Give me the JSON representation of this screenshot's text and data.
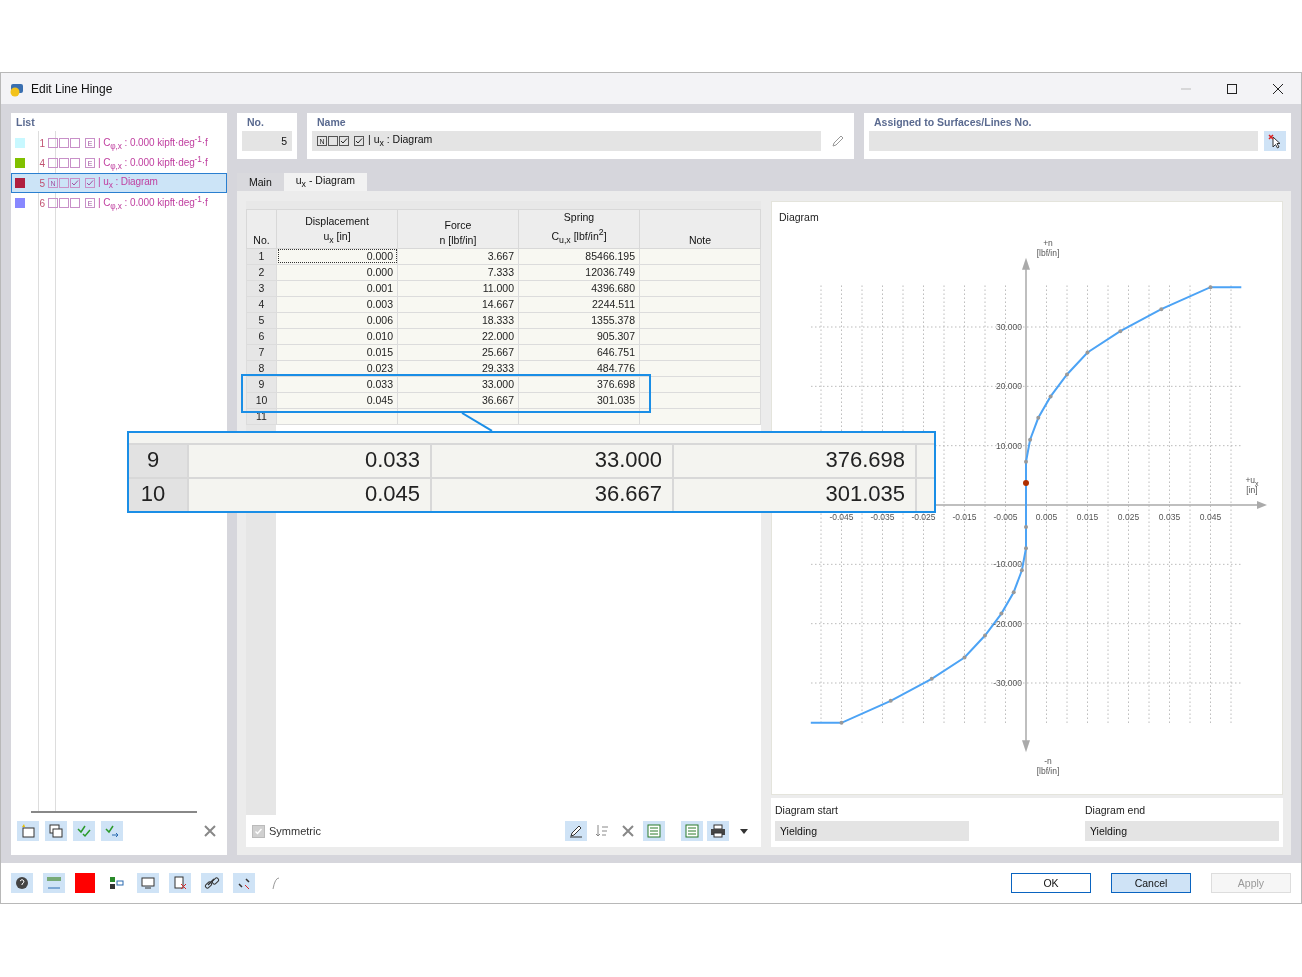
{
  "window": {
    "title": "Edit Line Hinge"
  },
  "list": {
    "title": "List",
    "items": [
      {
        "number": "1",
        "color": "#c8f8ff",
        "selected": false,
        "flags": [
          {
            "kind": "empty"
          },
          {
            "kind": "empty"
          },
          {
            "kind": "empty"
          }
        ],
        "extra": {
          "kind": "letter",
          "text": "E"
        },
        "text": "| C$_{φ,x}$ : 0.000 kipft·deg$^{-1}$·f"
      },
      {
        "number": "4",
        "color": "#80c000",
        "selected": false,
        "flags": [
          {
            "kind": "empty"
          },
          {
            "kind": "empty"
          },
          {
            "kind": "empty"
          }
        ],
        "extra": {
          "kind": "letter",
          "text": "E"
        },
        "text": "| C$_{φ,x}$ : 0.000 kipft·deg$^{-1}$·f"
      },
      {
        "number": "5",
        "color": "#b02040",
        "selected": true,
        "flags": [
          {
            "kind": "letter",
            "text": "N"
          },
          {
            "kind": "empty"
          },
          {
            "kind": "check"
          }
        ],
        "extra": {
          "kind": "check"
        },
        "text": "| u$_{x}$ : Diagram"
      },
      {
        "number": "6",
        "color": "#8888ff",
        "selected": false,
        "flags": [
          {
            "kind": "empty"
          },
          {
            "kind": "empty"
          },
          {
            "kind": "empty"
          }
        ],
        "extra": {
          "kind": "letter",
          "text": "E"
        },
        "text": "| C$_{φ,x}$ : 0.000 kipft·deg$^{-1}$·f"
      }
    ]
  },
  "number_field": {
    "label": "No.",
    "value": "5"
  },
  "name_field": {
    "label": "Name",
    "flags": [
      {
        "kind": "letter",
        "text": "N"
      },
      {
        "kind": "empty"
      },
      {
        "kind": "check"
      }
    ],
    "extra": {
      "kind": "check"
    },
    "value": "| u$_{x}$ : Diagram"
  },
  "assigned_field": {
    "label": "Assigned to Surfaces/Lines No."
  },
  "tabs": [
    {
      "label": "Main",
      "selected": false
    },
    {
      "label": "u$_{x}$ - Diagram",
      "selected": true
    }
  ],
  "table": {
    "columns": [
      {
        "lines": [
          "No."
        ]
      },
      {
        "lines": [
          "Displacement",
          "u$_{x}$ [in]"
        ]
      },
      {
        "lines": [
          "Force",
          "n [lbf/in]"
        ]
      },
      {
        "lines": [
          "Spring",
          "C$_{u,x}$ [lbf/in$^{2}$]"
        ]
      },
      {
        "lines": [
          "Note"
        ]
      }
    ],
    "rows": [
      {
        "cells": [
          "1",
          "0.000",
          "3.667",
          "85466.195"
        ]
      },
      {
        "cells": [
          "2",
          "0.000",
          "7.333",
          "12036.749"
        ]
      },
      {
        "cells": [
          "3",
          "0.001",
          "11.000",
          "4396.680"
        ]
      },
      {
        "cells": [
          "4",
          "0.003",
          "14.667",
          "2244.511"
        ]
      },
      {
        "cells": [
          "5",
          "0.006",
          "18.333",
          "1355.378"
        ]
      },
      {
        "cells": [
          "6",
          "0.010",
          "22.000",
          "905.307"
        ]
      },
      {
        "cells": [
          "7",
          "0.015",
          "25.667",
          "646.751"
        ]
      },
      {
        "cells": [
          "8",
          "0.023",
          "29.333",
          "484.776"
        ]
      },
      {
        "cells": [
          "9",
          "0.033",
          "33.000",
          "376.698"
        ]
      },
      {
        "cells": [
          "10",
          "0.045",
          "36.667",
          "301.035"
        ]
      },
      {
        "cells": [
          "11"
        ]
      }
    ]
  },
  "symmetric": {
    "label": "Symmetric",
    "checked": true,
    "disabled": true
  },
  "diagram": {
    "title": "Diagram",
    "y_top_label": [
      "+n",
      "[lbf/in]"
    ],
    "y_bottom_label": [
      "-n",
      "[lbf/in]"
    ],
    "x_label": [
      "+u$_{x}$",
      "[in]"
    ],
    "chart_data": {
      "type": "line",
      "grid": true,
      "x": [
        -0.0525,
        -0.045,
        -0.033,
        -0.023,
        -0.015,
        -0.01,
        -0.006,
        -0.003,
        -0.001,
        0.0,
        0.0,
        0.0,
        0.0,
        0.001,
        0.003,
        0.006,
        0.01,
        0.015,
        0.023,
        0.033,
        0.045,
        0.0525
      ],
      "series": [
        {
          "color": "#4ca3f5",
          "values": [
            -36.7,
            -36.7,
            -33.0,
            -29.3,
            -25.7,
            -22.0,
            -18.3,
            -14.7,
            -11.0,
            -7.3,
            -3.7,
            3.7,
            7.3,
            11.0,
            14.7,
            18.3,
            22.0,
            25.7,
            29.3,
            33.0,
            36.7,
            36.7
          ]
        }
      ],
      "xlim": [
        -0.0525,
        0.0525
      ],
      "ylim": [
        -40,
        40
      ],
      "xticks": [
        -0.045,
        -0.035,
        -0.025,
        -0.015,
        -0.005,
        0.005,
        0.015,
        0.025,
        0.035,
        0.045
      ],
      "yticks": [
        {
          "value": -30,
          "label": "-30.000"
        },
        {
          "value": -20,
          "label": "-20.000"
        },
        {
          "value": -10,
          "label": "-10.000"
        },
        {
          "value": 10,
          "label": "10.000"
        },
        {
          "value": 20,
          "label": "20.000"
        },
        {
          "value": 30,
          "label": "30.000"
        }
      ]
    }
  },
  "diagram_start": {
    "label": "Diagram start",
    "value": "Yielding"
  },
  "diagram_end": {
    "label": "Diagram end",
    "value": "Yielding"
  },
  "buttons": [
    {
      "label": "OK",
      "kind": "default",
      "disabled": false
    },
    {
      "label": "Cancel",
      "kind": "focused",
      "disabled": false
    },
    {
      "label": "Apply",
      "kind": "normal",
      "disabled": true
    }
  ],
  "zoom_callout": {
    "rows": [
      {
        "no": "9",
        "cells": [
          "0.033",
          "33.000",
          "376.698"
        ]
      },
      {
        "no": "10",
        "cells": [
          "0.045",
          "36.667",
          "301.035"
        ]
      }
    ]
  }
}
